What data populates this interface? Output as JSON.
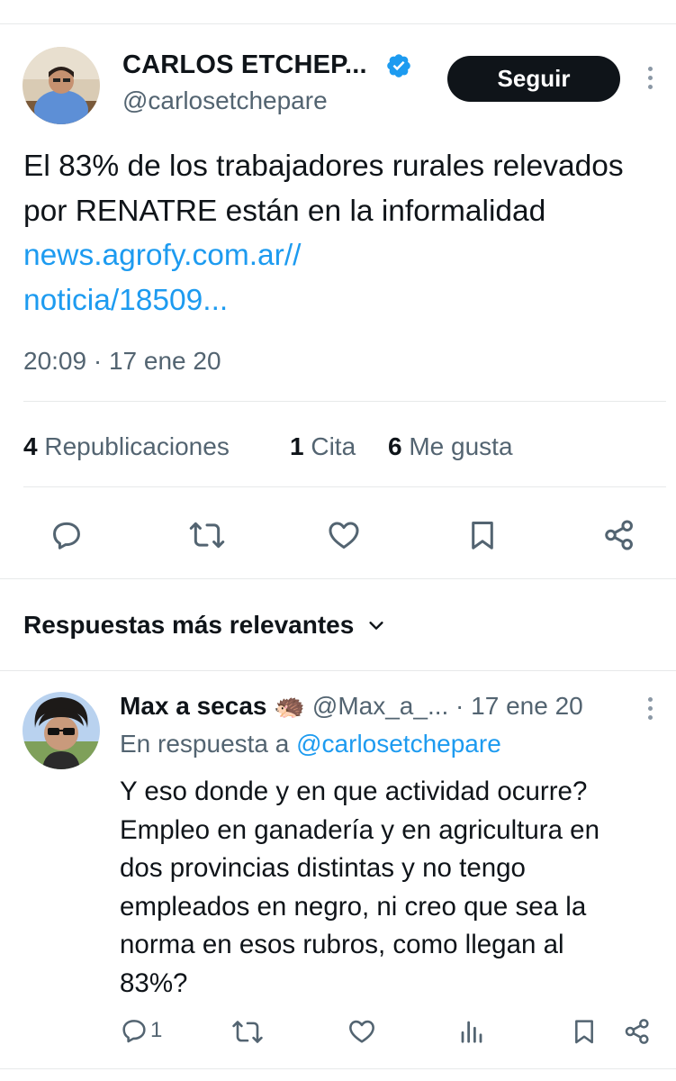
{
  "tweet": {
    "author_name": "CARLOS ETCHEP...",
    "handle": "@carlosetchepare",
    "follow_label": "Seguir",
    "text_main": "El 83% de los trabajadores rurales relevados por RENATRE están en la informalidad",
    "link_line1": "news.agrofy.com.ar//",
    "link_line2": "noticia/18509...",
    "timestamp": "20:09 · 17 ene 20",
    "stats": {
      "reposts_count": "4",
      "reposts_label": "Republicaciones",
      "quotes_count": "1",
      "quotes_label": "Cita",
      "likes_count": "6",
      "likes_label": "Me gusta"
    },
    "icons": [
      "reply-icon",
      "repost-icon",
      "like-icon",
      "bookmark-icon",
      "share-icon"
    ]
  },
  "replies_header": {
    "label": "Respuestas más relevantes"
  },
  "reply": {
    "author_name": "Max a secas",
    "author_emoji": "🦔",
    "handle_and_date": "@Max_a_... · 17 ene 20",
    "in_reply_prefix": "En respuesta a",
    "in_reply_handle": "@carlosetchepare",
    "lines": [
      "Y eso donde y en que actividad ocurre?",
      "Empleo en ganadería y en agricultura en",
      "dos provincias distintas y no tengo",
      "empleados en negro, ni creo que sea la",
      "norma en esos rubros, como llegan al",
      "83%?"
    ],
    "reply_count": "1",
    "icons": [
      "reply-icon",
      "repost-icon",
      "like-icon",
      "views-icon",
      "bookmark-icon",
      "share-icon"
    ]
  },
  "colors": {
    "accent": "#1d9bf0",
    "text": "#0f1419",
    "muted": "#536471",
    "divider": "#e7e9ea"
  }
}
